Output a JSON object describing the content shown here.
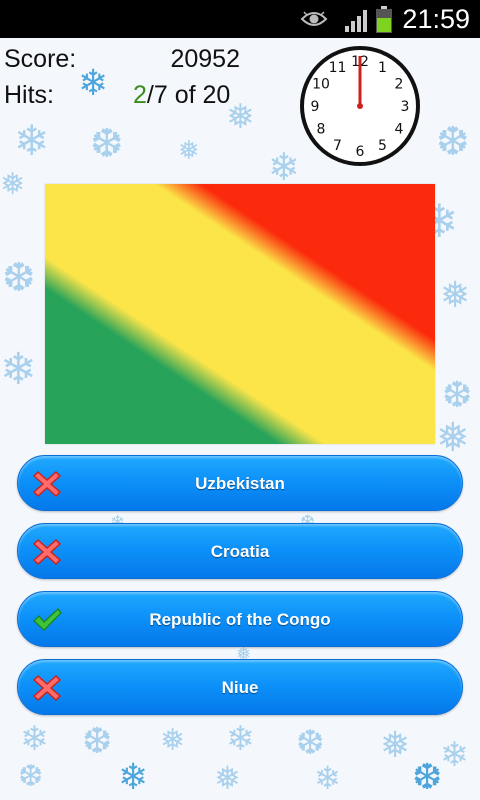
{
  "status_bar": {
    "time": "21:59",
    "icons": [
      "eye-icon",
      "signal-icon",
      "battery-icon"
    ]
  },
  "score": {
    "label": "Score:",
    "value": "20952"
  },
  "hits": {
    "label": "Hits:",
    "current": "2",
    "rest": "/7 of 20"
  },
  "clock": {
    "numbers": [
      "12",
      "1",
      "2",
      "3",
      "4",
      "5",
      "6",
      "7",
      "8",
      "9",
      "10",
      "11"
    ],
    "hand_color": "#d0201c"
  },
  "flag": {
    "colors": {
      "green": "#28a35a",
      "yellow": "#fbe549",
      "red": "#fb2a0c"
    }
  },
  "answers": [
    {
      "label": "Uzbekistan",
      "result": "wrong",
      "icon": "red-x-icon"
    },
    {
      "label": "Croatia",
      "result": "wrong",
      "icon": "red-x-icon"
    },
    {
      "label": "Republic of the Congo",
      "result": "correct",
      "icon": "green-check-icon"
    },
    {
      "label": "Niue",
      "result": "wrong",
      "icon": "red-x-icon"
    }
  ],
  "colors": {
    "button_blue": "#0c8ff8",
    "hits_green": "#3c8c1e",
    "snowflake": "#a9d0ec"
  }
}
